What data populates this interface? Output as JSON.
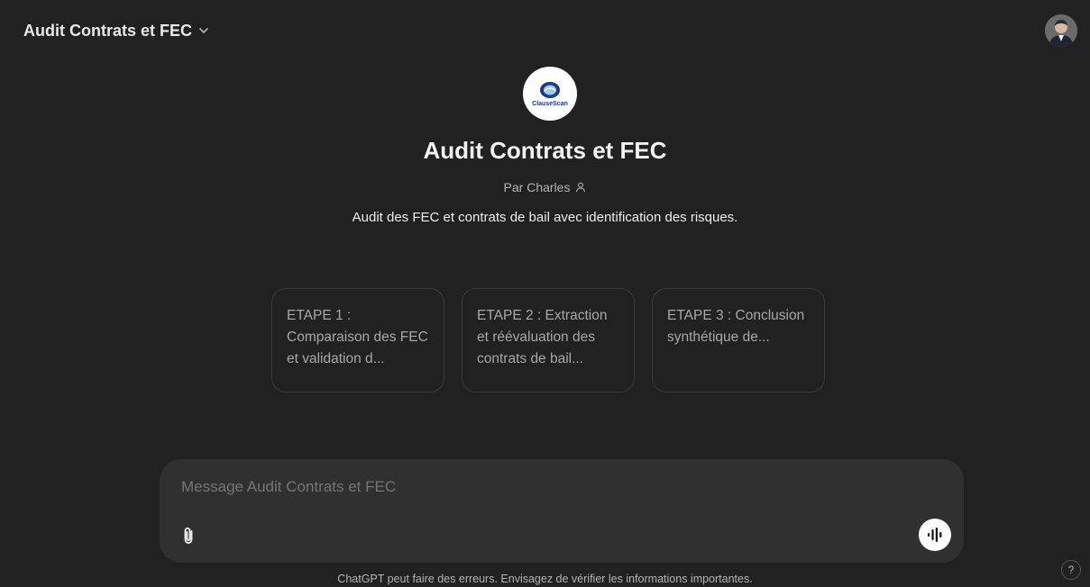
{
  "header": {
    "gpt_name": "Audit Contrats et FEC",
    "chevron_icon": "chevron-down-icon",
    "avatar_icon": "user-avatar"
  },
  "gpt": {
    "logo_text": "ClauseScan",
    "title": "Audit Contrats et FEC",
    "author": "Par Charles",
    "author_icon": "person-icon",
    "description": "Audit des FEC et contrats de bail avec identification des risques."
  },
  "starters": [
    {
      "label": "ETAPE 1 : Comparaison des FEC et validation d..."
    },
    {
      "label": "ETAPE 2 : Extraction et réévaluation des contrats de bail..."
    },
    {
      "label": "ETAPE 3 : Conclusion synthétique de..."
    }
  ],
  "composer": {
    "placeholder": "Message Audit Contrats et FEC",
    "attach_icon": "paperclip-icon",
    "voice_icon": "voice-mode-icon"
  },
  "footer": {
    "disclaimer": "ChatGPT peut faire des erreurs. Envisagez de vérifier les informations importantes.",
    "help_label": "?"
  },
  "colors": {
    "background": "#212121",
    "composer": "#303030",
    "card_border": "#3a3a3a",
    "text_muted": "#b4b4b4"
  }
}
